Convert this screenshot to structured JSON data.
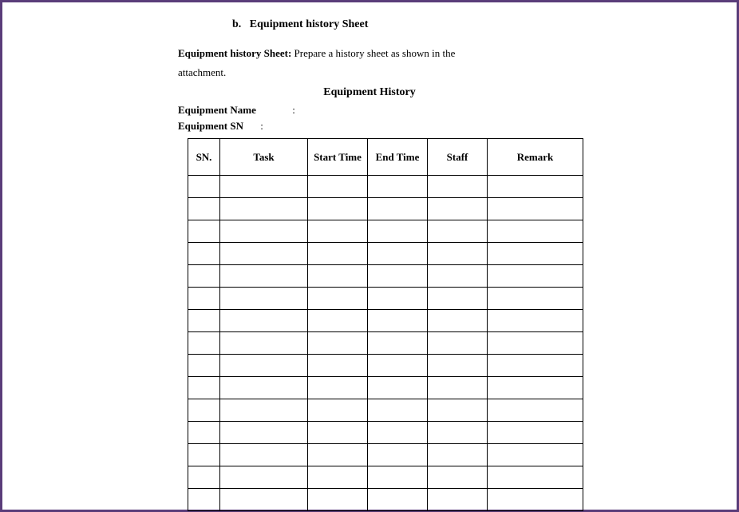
{
  "section": {
    "marker": "b.",
    "heading": "Equipment history Sheet"
  },
  "instruction": {
    "label": "Equipment history Sheet:",
    "text_line1": "Prepare a history sheet as shown in the",
    "text_line2": "attachment."
  },
  "title": "Equipment History",
  "fields": {
    "equipment_name": {
      "label": "Equipment Name",
      "sep": ":"
    },
    "equipment_sn": {
      "label": "Equipment SN",
      "sep": ":"
    }
  },
  "table": {
    "headers": {
      "sn": "SN.",
      "task": "Task",
      "start": "Start Time",
      "end": "End Time",
      "staff": "Staff",
      "remark": "Remark"
    },
    "row_count": 15
  }
}
